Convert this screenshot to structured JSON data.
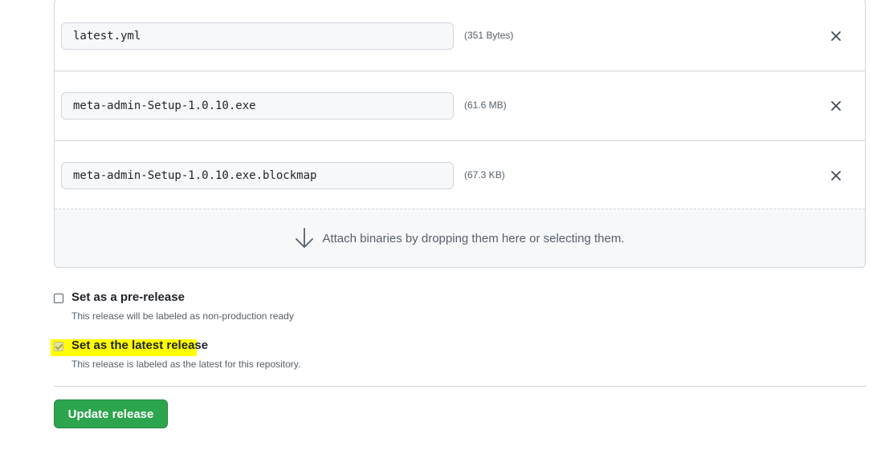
{
  "assets": [
    {
      "filename": "latest.yml",
      "size": "(351 Bytes)"
    },
    {
      "filename": "meta-admin-Setup-1.0.10.exe",
      "size": "(61.6 MB)"
    },
    {
      "filename": "meta-admin-Setup-1.0.10.exe.blockmap",
      "size": "(67.3 KB)"
    }
  ],
  "dropzone": {
    "text": "Attach binaries by dropping them here or selecting them.",
    "icon": "arrow-down-icon"
  },
  "options": {
    "prerelease": {
      "title": "Set as a pre-release",
      "description": "This release will be labeled as non-production ready",
      "checked": false
    },
    "latest": {
      "title": "Set as the latest release",
      "description": "This release is labeled as the latest for this repository.",
      "checked": true,
      "disabled": true
    }
  },
  "actions": {
    "update_label": "Update release"
  },
  "colors": {
    "primary_button": "#2da44e",
    "highlight": "#ffff00",
    "border": "#d0d7de"
  }
}
